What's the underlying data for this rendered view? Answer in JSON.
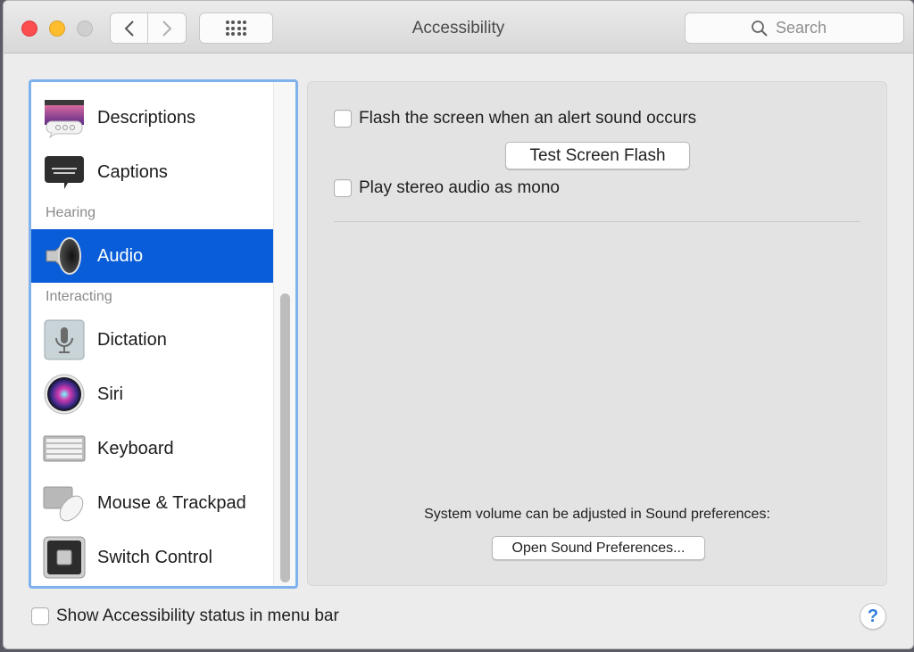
{
  "window": {
    "title": "Accessibility",
    "search": {
      "placeholder": "Search",
      "value": ""
    }
  },
  "sidebar": {
    "items": [
      {
        "label": "Descriptions",
        "icon": "descriptions-icon"
      },
      {
        "label": "Captions",
        "icon": "captions-icon"
      },
      {
        "section": "Hearing"
      },
      {
        "label": "Audio",
        "icon": "speaker-icon",
        "selected": true
      },
      {
        "section": "Interacting"
      },
      {
        "label": "Dictation",
        "icon": "microphone-icon"
      },
      {
        "label": "Siri",
        "icon": "siri-icon"
      },
      {
        "label": "Keyboard",
        "icon": "keyboard-icon"
      },
      {
        "label": "Mouse & Trackpad",
        "icon": "mouse-trackpad-icon"
      },
      {
        "label": "Switch Control",
        "icon": "switch-control-icon"
      }
    ],
    "sections": {
      "hearing": "Hearing",
      "interacting": "Interacting"
    },
    "selected_color": "#0a5dd8"
  },
  "panel": {
    "flash_screen": {
      "label": "Flash the screen when an alert sound occurs",
      "checked": false
    },
    "test_flash_button": "Test Screen Flash",
    "mono_audio": {
      "label": "Play stereo audio as mono",
      "checked": false
    },
    "volume_note": "System volume can be adjusted in Sound preferences:",
    "open_sound_button": "Open Sound Preferences..."
  },
  "footer": {
    "show_status": {
      "label": "Show Accessibility status in menu bar",
      "checked": false
    },
    "help_label": "?"
  }
}
